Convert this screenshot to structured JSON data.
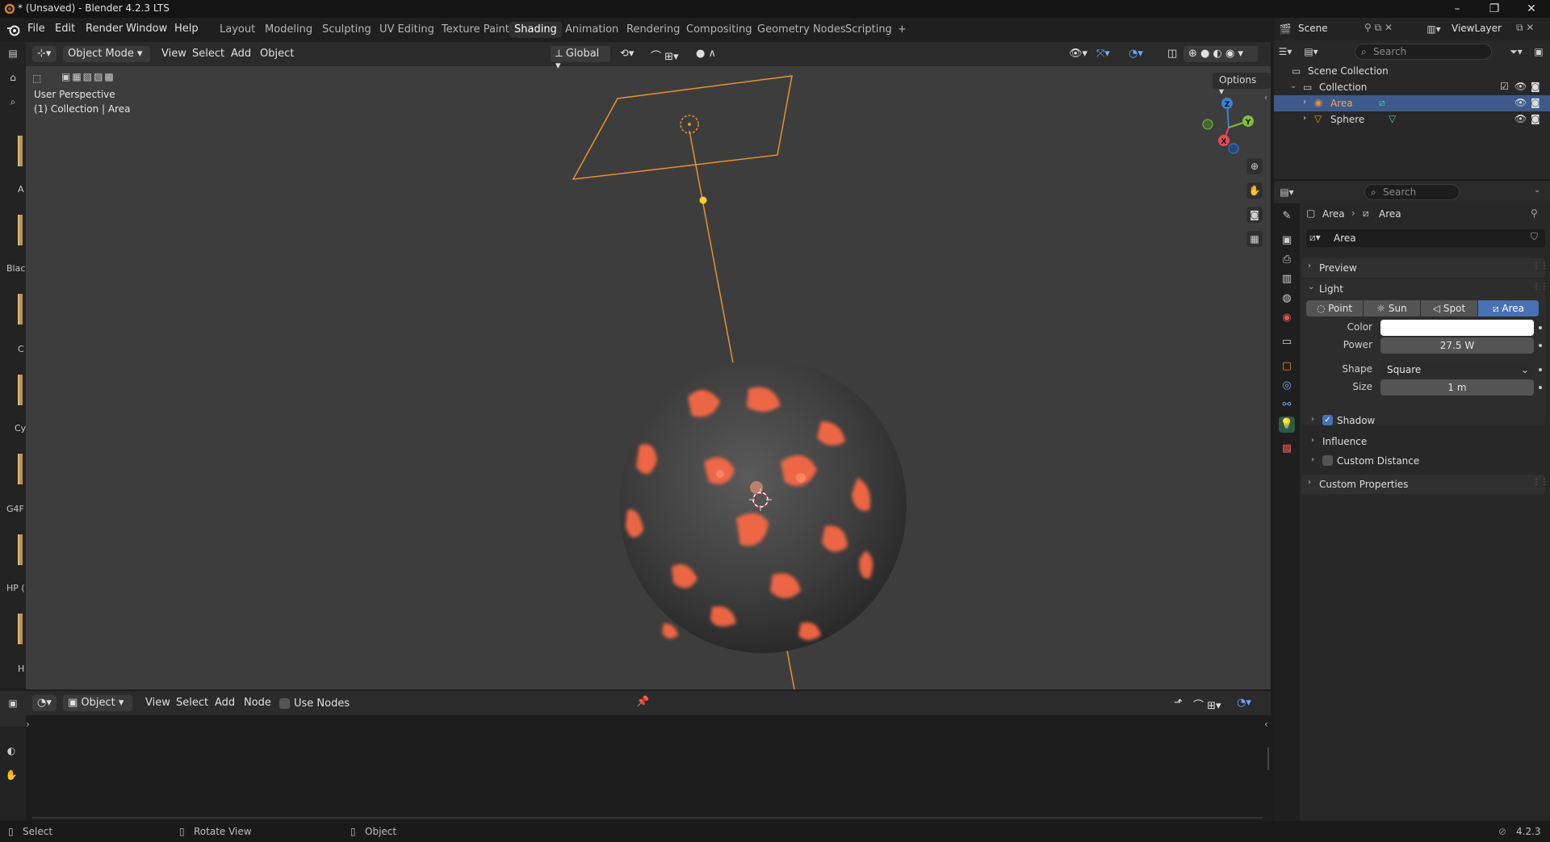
{
  "window": {
    "title": "* (Unsaved) - Blender 4.2.3 LTS",
    "controls": [
      "–",
      "❐",
      "✕"
    ]
  },
  "menu": [
    "File",
    "Edit",
    "Render",
    "Window",
    "Help"
  ],
  "workspaces": [
    "Layout",
    "Modeling",
    "Sculpting",
    "UV Editing",
    "Texture Paint",
    "Shading",
    "Animation",
    "Rendering",
    "Compositing",
    "Geometry Nodes",
    "Scripting"
  ],
  "active_workspace": "Shading",
  "scene": {
    "name": "Scene",
    "view_layer": "ViewLayer"
  },
  "viewport": {
    "mode": "Object Mode",
    "menus": [
      "View",
      "Select",
      "Add",
      "Object"
    ],
    "transform_orientation": "Global",
    "options_label": "Options",
    "perspective_label": "User Perspective",
    "collection_label": "(1) Collection | Area",
    "gizmo": {
      "z": "Z",
      "y": "Y",
      "x": "X"
    }
  },
  "left_tool_labels": [
    "A",
    "Blac",
    "C",
    "Cy",
    "G4F",
    "HP (",
    "H"
  ],
  "node_editor": {
    "type": "Object",
    "menus": [
      "View",
      "Select",
      "Add",
      "Node"
    ],
    "use_nodes_label": "Use Nodes"
  },
  "status": {
    "select": "Select",
    "rotate": "Rotate View",
    "object": "Object",
    "version": "4.2.3"
  },
  "outliner": {
    "search_placeholder": "Search",
    "items": [
      {
        "label": "Scene Collection"
      },
      {
        "label": "Collection"
      },
      {
        "label": "Area"
      },
      {
        "label": "Sphere"
      }
    ]
  },
  "properties": {
    "search_placeholder": "Search",
    "breadcrumb": [
      "Area",
      "Area"
    ],
    "datablock_name": "Area",
    "sections": {
      "preview": "Preview",
      "light": "Light",
      "shadow": "Shadow",
      "influence": "Influence",
      "custom_distance": "Custom Distance",
      "custom_properties": "Custom Properties"
    },
    "light_types": [
      "Point",
      "Sun",
      "Spot",
      "Area"
    ],
    "active_light_type": "Area",
    "fields": {
      "color_label": "Color",
      "color_value": "#ffffff",
      "power_label": "Power",
      "power_value": "27.5 W",
      "shape_label": "Shape",
      "shape_value": "Square",
      "size_label": "Size",
      "size_value": "1 m"
    }
  },
  "colors": {
    "accent_blue": "#4772b3",
    "selection_orange": "#e8922c",
    "lava": "#ff6a45"
  }
}
